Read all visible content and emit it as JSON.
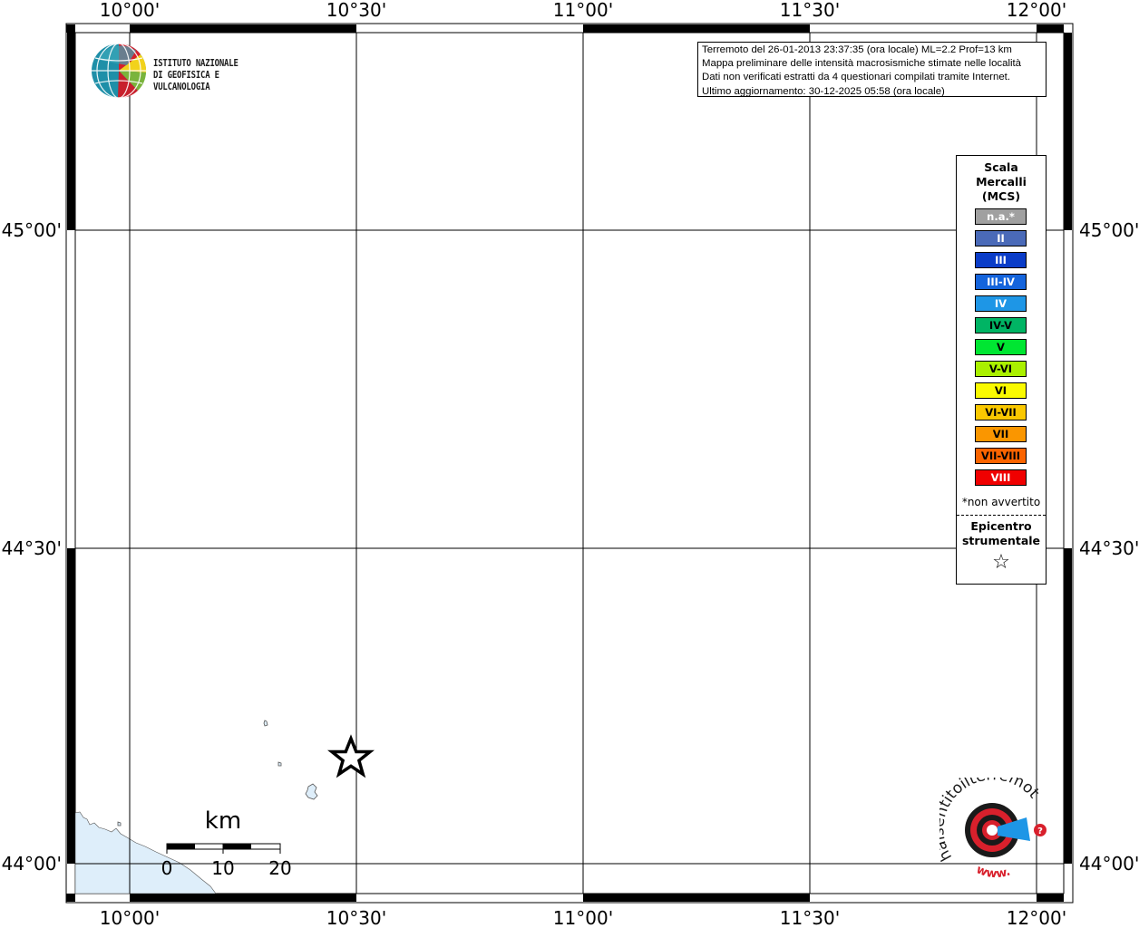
{
  "map": {
    "lon_ticks": [
      "10°00'",
      "10°30'",
      "11°00'",
      "11°30'",
      "12°00'"
    ],
    "lat_ticks": [
      "45°00'",
      "44°30'",
      "44°00'"
    ],
    "scalebar": {
      "unit": "km",
      "labels": [
        "0",
        "10",
        "20"
      ]
    }
  },
  "info": {
    "line1": "Terremoto del 26-01-2013 23:37:35 (ora locale) ML=2.2 Prof=13 km",
    "line2": "Mappa preliminare delle intensità macrosismiche stimate nelle località",
    "line3": "Dati non verificati estratti da 4 questionari compilati tramite Internet.",
    "line4": "Ultimo aggiornamento: 30-12-2025 05:58 (ora locale)"
  },
  "legend": {
    "title_lines": [
      "Scala",
      "Mercalli",
      "(MCS)"
    ],
    "items": [
      {
        "label": "n.a.*",
        "color": "#a0a0a0",
        "text_color": "#ffffff"
      },
      {
        "label": "II",
        "color": "#4a6ab8",
        "text_color": "#ffffff"
      },
      {
        "label": "III",
        "color": "#0a3cc8",
        "text_color": "#ffffff"
      },
      {
        "label": "III-IV",
        "color": "#1464dc",
        "text_color": "#ffffff"
      },
      {
        "label": "IV",
        "color": "#1e96e6",
        "text_color": "#ffffff"
      },
      {
        "label": "IV-V",
        "color": "#00b464",
        "text_color": "#000000"
      },
      {
        "label": "V",
        "color": "#00e632",
        "text_color": "#000000"
      },
      {
        "label": "V-VI",
        "color": "#aaf000",
        "text_color": "#000000"
      },
      {
        "label": "VI",
        "color": "#fafa00",
        "text_color": "#000000"
      },
      {
        "label": "VI-VII",
        "color": "#fac800",
        "text_color": "#000000"
      },
      {
        "label": "VII",
        "color": "#fa9600",
        "text_color": "#000000"
      },
      {
        "label": "VII-VIII",
        "color": "#fa6400",
        "text_color": "#000000"
      },
      {
        "label": "VIII",
        "color": "#f00000",
        "text_color": "#ffffff"
      }
    ],
    "note": "*non avvertito",
    "epicenter_lines": [
      "Epicentro",
      "strumentale"
    ],
    "epicenter_icon": "star-outline-icon"
  },
  "logos": {
    "ingv_lines": [
      "ISTITUTO NAZIONALE",
      "DI GEOFISICA E VULCANOLOGIA"
    ],
    "hst_text": "haisentitoilterremoto.it",
    "hst_url": "www."
  },
  "colors": {
    "sea": "#deeefa",
    "frame": "#000000",
    "grid": "#000000"
  }
}
